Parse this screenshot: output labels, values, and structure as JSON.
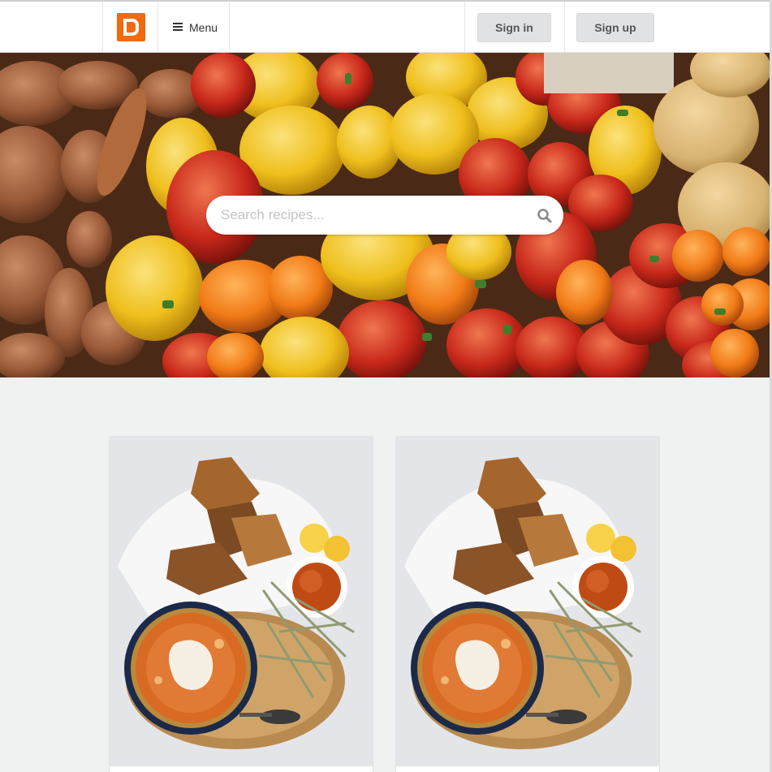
{
  "app": {
    "logo_letter": "D",
    "brand_color": "#f26a0f"
  },
  "header": {
    "menu_label": "Menu",
    "menu_icon": "hamburger-icon",
    "signin_label": "Sign in",
    "signup_label": "Sign up"
  },
  "hero": {
    "search_placeholder": "Search recipes...",
    "search_value": "",
    "search_icon": "search-icon"
  },
  "cards": [
    {
      "image": "soup-bowl-with-bread-photo"
    },
    {
      "image": "soup-bowl-with-bread-photo"
    }
  ]
}
